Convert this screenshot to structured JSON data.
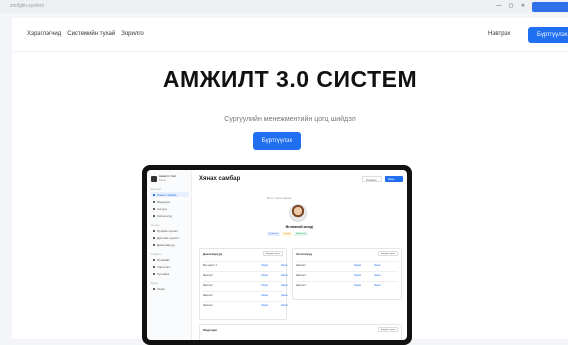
{
  "browser": {
    "url": "zorilgiin.system",
    "controls": "— ▢ ✕"
  },
  "nav": {
    "links": [
      "Хэрэглэгчид",
      "Системийн тухай",
      "Зорилго"
    ],
    "login": "Нэвтрэх",
    "signup": "Бүртгүүлэх"
  },
  "hero": {
    "title": "АМЖИЛТ 3.0 СИСТЕМ",
    "subtitle": "Сургуулийн менежментийн цогц шийдэл",
    "cta": "Бүртгүүлэх"
  },
  "preview": {
    "brand_line1": "Амжилт Сис.",
    "brand_line2": "Багш",
    "sidebar_groups": [
      "Ерөнхий",
      "Хичээл",
      "Тохиргоо",
      "Бусад"
    ],
    "sidebar_items": [
      "Хянах самбар",
      "Мэдэгдэл",
      "Ангиуд",
      "Хичээлүүд",
      "Ирцийн хүснэгт",
      "Дүнгийн хүснэгт",
      "Даалгаврууд",
      "Профайл",
      "Хэрэглэгч",
      "Тусламж",
      "Гарах"
    ],
    "main_title": "Хянах самбар",
    "toolbar_btn1": "Тохиргоо",
    "toolbar_btn2": "Шинэ",
    "breadcrumb": "Багш / Хянах самбар",
    "profile_name": "Өглөөний мэнд!",
    "tags": [
      "2 хичээл",
      "3 анги",
      "Идэвхтэй"
    ],
    "card1": {
      "title": "Даалгаврууд",
      "action": "Бүгдийг харах",
      "rows": [
        {
          "l": "Бие даалт 1",
          "r": "Харах",
          "r2": "Засах"
        },
        {
          "l": "Шалгалт",
          "r": "Харах",
          "r2": "Засах"
        },
        {
          "l": "Шалгалт",
          "r": "Харах",
          "r2": "Засах"
        },
        {
          "l": "Шалгалт",
          "r": "Харах",
          "r2": "Засах"
        },
        {
          "l": "Шалгалт",
          "r": "Харах",
          "r2": "Засах"
        }
      ]
    },
    "card2": {
      "title": "Хичээлүүд",
      "action": "Бүгдийг харах",
      "rows": [
        {
          "l": "Шалгалт",
          "r": "Харах",
          "r2": "Засах"
        },
        {
          "l": "Шалгалт",
          "r": "Харах",
          "r2": "Засах"
        },
        {
          "l": "Шалгалт",
          "r": "Харах",
          "r2": "Засах"
        }
      ]
    },
    "card3": {
      "title": "Мэдэгдэл",
      "action": "Бүгдийг харах"
    }
  },
  "colors": {
    "accent": "#1f6ff0",
    "text": "#111111"
  }
}
